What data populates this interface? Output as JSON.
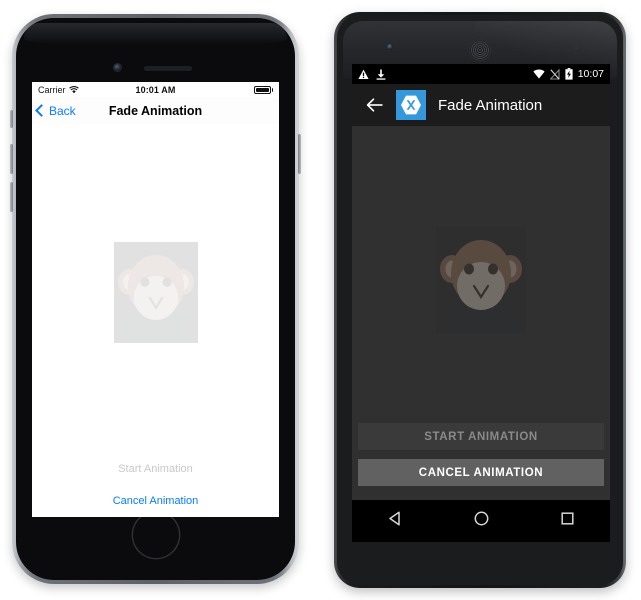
{
  "ios": {
    "status_bar": {
      "carrier": "Carrier",
      "wifi_icon": "wifi-icon",
      "time": "10:01 AM",
      "battery_icon": "battery-full-icon"
    },
    "nav_bar": {
      "back_label": "Back",
      "back_icon": "chevron-left-icon",
      "title": "Fade Animation"
    },
    "content": {
      "image_name": "monkey-image",
      "image_opacity": 0.08
    },
    "actions": {
      "start_label": "Start Animation",
      "start_enabled": false,
      "cancel_label": "Cancel Animation",
      "cancel_enabled": true
    },
    "colors": {
      "tint": "#0a7cff",
      "disabled_text": "#c9c9ce",
      "background": "#ffffff"
    }
  },
  "android": {
    "status_bar": {
      "warning_icon": "warning-triangle-icon",
      "download_icon": "download-icon",
      "wifi_icon": "wifi-icon",
      "signal_icon": "signal-off-icon",
      "battery_icon": "battery-charging-icon",
      "time": "10:07"
    },
    "toolbar": {
      "back_icon": "arrow-left-icon",
      "app_icon": "xamarin-logo-icon",
      "title": "Fade Animation"
    },
    "content": {
      "image_name": "monkey-image",
      "image_opacity": 0.3
    },
    "actions": {
      "start_label": "START ANIMATION",
      "start_enabled": false,
      "cancel_label": "CANCEL ANIMATION",
      "cancel_enabled": true
    },
    "nav_bar": {
      "back_icon": "nav-back-triangle-icon",
      "home_icon": "nav-home-circle-icon",
      "recents_icon": "nav-recents-square-icon"
    },
    "colors": {
      "accent": "#3498db",
      "toolbar": "#1c1c1c",
      "background": "#303030",
      "button_disabled": "#3a3a3a",
      "button_enabled": "#616161"
    }
  }
}
